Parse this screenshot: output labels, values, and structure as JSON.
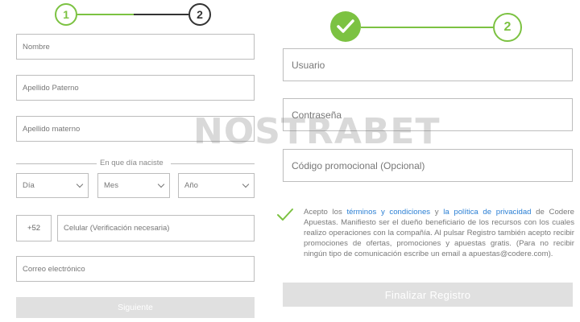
{
  "left": {
    "stepper": {
      "step1": "1",
      "step2": "2"
    },
    "fields": {
      "nombre": "Nombre",
      "apellido_paterno": "Apellido Paterno",
      "apellido_materno": "Apellido materno",
      "birth_label": "En que día naciste",
      "dia": "Día",
      "mes": "Mes",
      "anio": "Año",
      "phone_prefix": "+52",
      "celular": "Celular (Verificación necesaria)",
      "correo": "Correo electrónico"
    },
    "next_button": "Siguiente"
  },
  "right": {
    "stepper": {
      "step2": "2"
    },
    "fields": {
      "usuario": "Usuario",
      "contrasena": "Contraseña",
      "codigo": "Código promocional (Opcional)"
    },
    "terms": {
      "prefix": "Acepto los ",
      "link1": "términos y condiciones",
      "middle": " y ",
      "link2": "la política de privacidad",
      "suffix": " de Codere Apuestas. Manifiesto ser el dueño beneficiario de los recursos con los cuales realizo operaciones con la compañía. Al pulsar Registro también acepto recibir promociones de ofertas, promociones y apuestas gratis. (Para no recibir ningún tipo de comunicación escribe un email a apuestas@codere.com)."
    },
    "finish_button": "Finalizar Registro"
  },
  "watermark": "NOSTRABET",
  "colors": {
    "accent_green": "#7cc242",
    "dark": "#333333",
    "link_blue": "#2a7fd4",
    "button_gray": "#e0e0e0"
  }
}
